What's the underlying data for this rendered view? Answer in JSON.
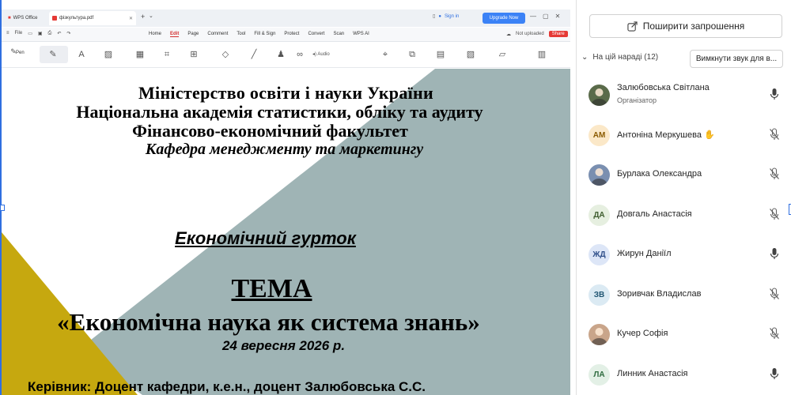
{
  "wps": {
    "tab_app": "WPS Office",
    "tab_doc": "фізкультура.pdf",
    "sign_in": "Sign in",
    "upgrade": "Upgrade Now",
    "file_menu": "File",
    "menu_items": [
      "Home",
      "Edit",
      "Page",
      "Comment",
      "Tool",
      "Fill & Sign",
      "Protect",
      "Convert",
      "Scan",
      "WPS AI"
    ],
    "active_menu": "Edit",
    "not_uploaded": "Not uploaded",
    "share": "Share",
    "pen_label": "Pen",
    "audio_label": "Audio"
  },
  "document": {
    "ministry": "Міністерство освіти і науки України",
    "academy": "Національна академія статистики, обліку та аудиту",
    "faculty": "Фінансово-економічний факультет",
    "department": "Кафедра менеджменту та маркетингу",
    "circle": "Економічний гурток",
    "topic_label": "ТЕМА",
    "topic_title": "«Економічна наука як система знань»",
    "date": "24 вересня 2026 р.",
    "leader": "Керівник: Доцент кафедри, к.е.н., доцент Залюбовська С.С.",
    "colors": {
      "shape_gray": "#9fb4b5",
      "shape_yellow": "#c6a80f"
    }
  },
  "panel": {
    "invite_label": "Поширити запрошення",
    "section_label": "На цій нараді (12)",
    "mute_all_label": "Вимкнути звук для в...",
    "participants": [
      {
        "name": "Залюбовська Світлана",
        "role": "Організатор",
        "initials": "",
        "avatar_color": "#5a6b4a",
        "mic": "on",
        "photo": true
      },
      {
        "name": "Антоніна Меркушева",
        "role": "",
        "initials": "АМ",
        "avatar_color": "#fbe8c8",
        "text_color": "#8a5a00",
        "mic": "off",
        "hand": true
      },
      {
        "name": "Бурлака Олександра",
        "role": "",
        "initials": "",
        "avatar_color": "#7a8fb0",
        "mic": "off",
        "photo": true
      },
      {
        "name": "Довгаль Анастасія",
        "role": "",
        "initials": "ДА",
        "avatar_color": "#e6efe0",
        "text_color": "#3f5e2f",
        "mic": "off"
      },
      {
        "name": "Жирун Даніїл",
        "role": "",
        "initials": "ЖД",
        "avatar_color": "#dde6f7",
        "text_color": "#2f4f8a",
        "mic": "on"
      },
      {
        "name": "Зоривчак Владислав",
        "role": "",
        "initials": "ЗВ",
        "avatar_color": "#dbeaf3",
        "text_color": "#1f5572",
        "mic": "off"
      },
      {
        "name": "Кучер Софія",
        "role": "",
        "initials": "",
        "avatar_color": "#c9a58a",
        "mic": "off",
        "photo": true
      },
      {
        "name": "Линник Анастасія",
        "role": "",
        "initials": "ЛА",
        "avatar_color": "#e3f0e6",
        "text_color": "#2e6b3e",
        "mic": "on"
      }
    ]
  }
}
